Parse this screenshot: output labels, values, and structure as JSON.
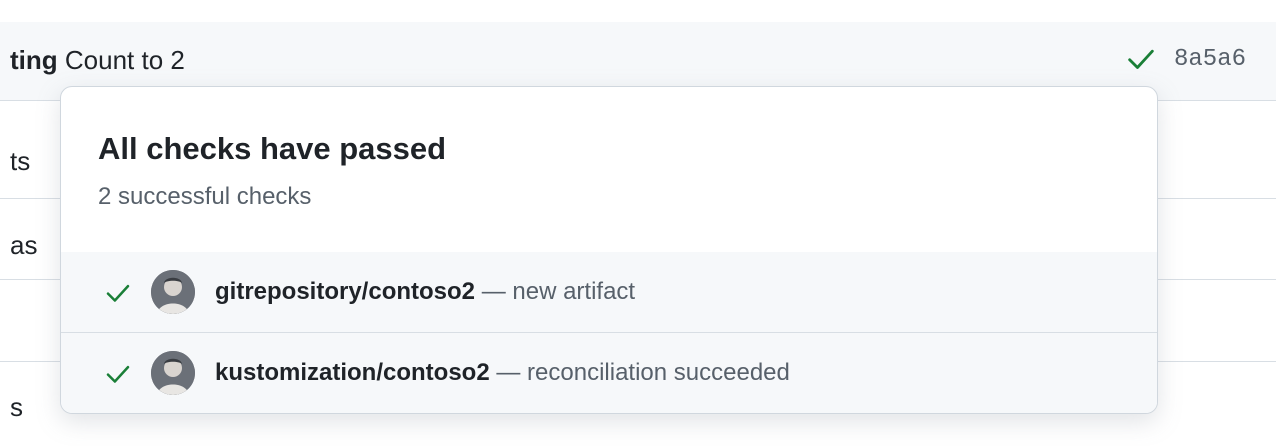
{
  "commit": {
    "title_prefix": "ting",
    "title_rest": " Count to 2",
    "sha": "8a5a6",
    "status_icon": "check-icon",
    "status_color": "#1a7f37"
  },
  "file_fragments": [
    "ts",
    "as",
    "",
    "s"
  ],
  "popover": {
    "title": "All checks have passed",
    "subtitle": "2 successful checks",
    "checks": [
      {
        "name": "gitrepository/contoso2",
        "separator": " — ",
        "description": "new artifact",
        "status_icon": "check-icon",
        "avatar_icon": "avatar"
      },
      {
        "name": "kustomization/contoso2",
        "separator": " — ",
        "description": "reconciliation succeeded",
        "status_icon": "check-icon",
        "avatar_icon": "avatar"
      }
    ]
  },
  "colors": {
    "success": "#1a7f37",
    "muted_text": "#57606a",
    "border": "#d0d7de",
    "row_background": "#f6f8fa"
  }
}
